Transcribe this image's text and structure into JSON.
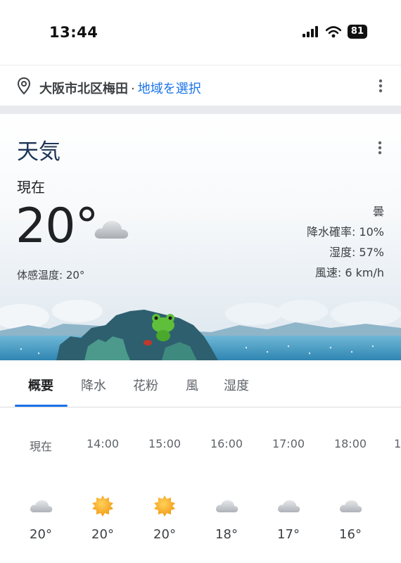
{
  "status_bar": {
    "time": "13:44",
    "battery": "81",
    "icons": [
      "signal-icon",
      "wifi-icon",
      "battery-icon"
    ]
  },
  "location": {
    "city": "大阪市北区梅田",
    "separator": "·",
    "select_link": "地域を選択",
    "icon": "location-pin-icon"
  },
  "weather": {
    "title": "天気",
    "now_label": "現在",
    "temperature": "20°",
    "feels_like": "体感温度: 20°",
    "condition": "曇",
    "precip": "降水確率: 10%",
    "humidity": "湿度: 57%",
    "wind": "風速: 6 km/h",
    "condition_icon": "cloud-icon"
  },
  "tabs": [
    "概要",
    "降水",
    "花粉",
    "風",
    "湿度"
  ],
  "active_tab": 0,
  "hourly": [
    {
      "time": "現在",
      "icon": "cloud",
      "temp": "20°"
    },
    {
      "time": "14:00",
      "icon": "sun",
      "temp": "20°"
    },
    {
      "time": "15:00",
      "icon": "sun",
      "temp": "20°"
    },
    {
      "time": "16:00",
      "icon": "cloud",
      "temp": "18°"
    },
    {
      "time": "17:00",
      "icon": "cloud",
      "temp": "17°"
    },
    {
      "time": "18:00",
      "icon": "cloud",
      "temp": "16°"
    },
    {
      "time": "1",
      "icon": "cloud",
      "temp": ""
    }
  ],
  "colors": {
    "link": "#1a73e8",
    "title": "#1f3556",
    "sun": "#f6a623",
    "cloud": "#c9ccd1"
  }
}
